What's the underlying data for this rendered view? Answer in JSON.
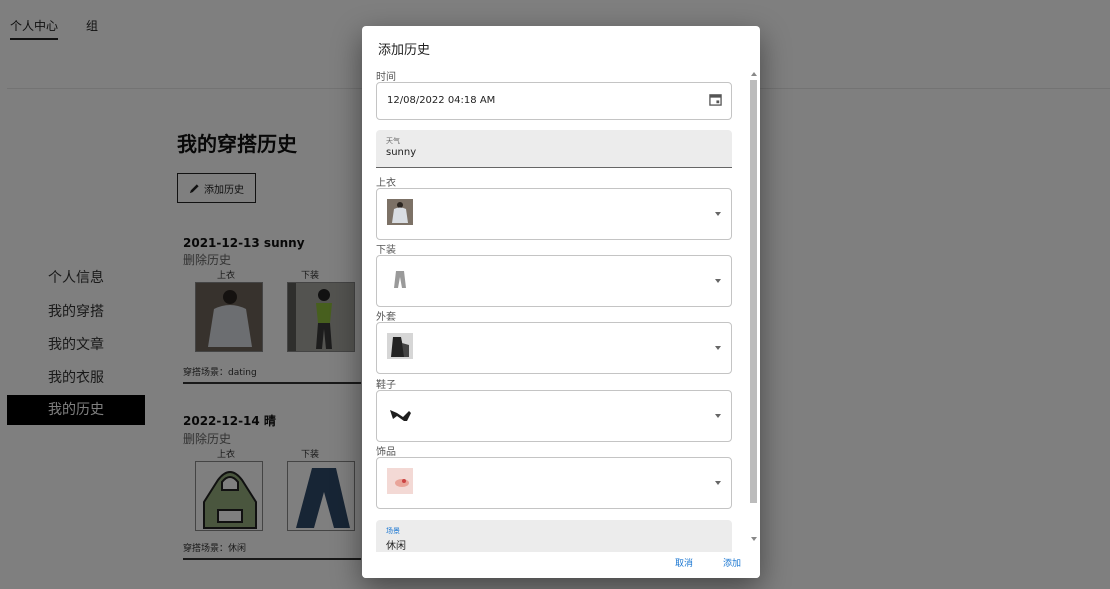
{
  "topnav": {
    "tabs": [
      "个人中心",
      "组"
    ]
  },
  "sidebar": {
    "items": [
      "个人信息",
      "我的穿搭",
      "我的文章",
      "我的衣服",
      "我的历史"
    ],
    "active_index": 4
  },
  "page": {
    "title": "我的穿搭历史",
    "add_button": "添加历史",
    "records": [
      {
        "heading": "2021-12-13 sunny",
        "delete": "删除历史",
        "top_label": "上衣",
        "bottom_label": "下装",
        "scene": "穿搭场景：dating"
      },
      {
        "heading": "2022-12-14 晴",
        "delete": "删除历史",
        "top_label": "上衣",
        "bottom_label": "下装",
        "scene": "穿搭场景：休闲"
      }
    ]
  },
  "dialog": {
    "title": "添加历史",
    "time": {
      "label": "时间",
      "value": "12/08/2022 04:18 AM"
    },
    "weather": {
      "label": "天气",
      "value": "sunny"
    },
    "top": {
      "label": "上衣"
    },
    "bottom": {
      "label": "下装"
    },
    "outerwear": {
      "label": "外套"
    },
    "shoes": {
      "label": "鞋子"
    },
    "accessory": {
      "label": "饰品"
    },
    "scene": {
      "label": "场景",
      "value": "休闲"
    },
    "cancel": "取消",
    "confirm": "添加"
  },
  "colors": {
    "accent": "#1976d2",
    "active_nav": "#000000",
    "overlay": "rgba(0,0,0,0.5)"
  }
}
